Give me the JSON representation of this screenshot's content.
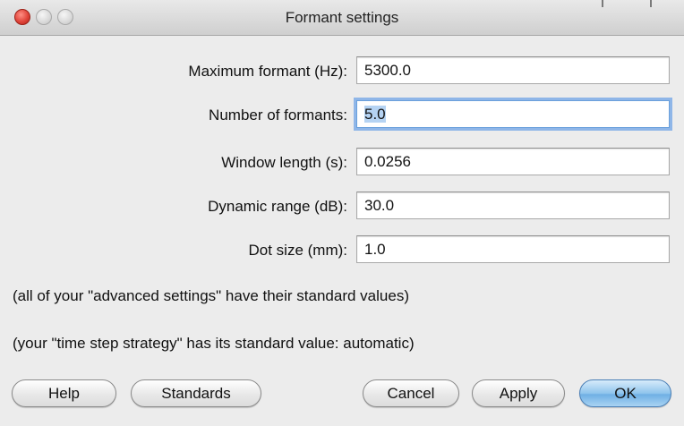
{
  "window": {
    "title": "Formant settings"
  },
  "form": {
    "fields": [
      {
        "label": "Maximum formant (Hz):",
        "value": "5300.0"
      },
      {
        "label": "Number of formants:",
        "value": "5.0"
      },
      {
        "label": "Window length (s):",
        "value": "0.0256"
      },
      {
        "label": "Dynamic range (dB):",
        "value": "30.0"
      },
      {
        "label": "Dot size (mm):",
        "value": "1.0"
      }
    ]
  },
  "notes": {
    "advanced": "(all of your \"advanced settings\" have their standard values)",
    "time_step": "(your \"time step strategy\" has its standard value: automatic)"
  },
  "buttons": {
    "help": "Help",
    "standards": "Standards",
    "cancel": "Cancel",
    "apply": "Apply",
    "ok": "OK"
  },
  "colors": {
    "focus_ring": "#8fb6e8",
    "default_button": "#6fb0e4",
    "close_button": "#e0443a"
  }
}
